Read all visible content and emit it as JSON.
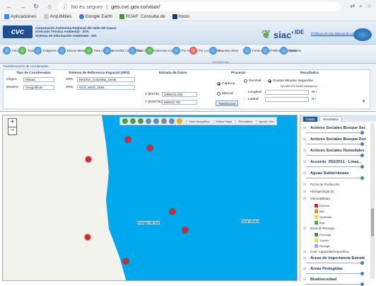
{
  "browser": {
    "security_label": "No es seguro",
    "url": "geo.cvc.gov.co/visor/",
    "bookmarks": [
      "Aplicaciones",
      "ArqUtilities",
      "Google Earth",
      "RUAF: Consulta de",
      "Inicio"
    ]
  },
  "header": {
    "logo_text": "cvc",
    "org_line1": "Corporación Autónoma Regional del Valle del Cauca",
    "org_line2": "Dirección Técnica Ambiental - DTA",
    "org_line3": "Sistema de Información Ambiental - SIA",
    "siac_label": "siac",
    "ide_label": "IDE",
    "links": "Políticas de Uso  Manual de Usuario"
  },
  "toolbar": {
    "items": [
      "Inicio",
      "Todo",
      "Imágenes raster",
      "Buscar Metadatos",
      "Para consultar",
      "Consulta Cartográfica",
      "Buscar Área",
      "Adicionar Capa",
      "Por Atributo",
      "Por Localización",
      "Exportar datos",
      "Punto / Línea",
      "Polilínea / Polígono",
      "Medición"
    ],
    "group_label": "Herramientas"
  },
  "panel": {
    "title": "Transformación de coordenadas",
    "coord_type_header": "Tipo de Coordenadas",
    "srs_header": "Sistema de Referencia Espacial (SRS)",
    "data_entry_header": "Entrada de Datos",
    "process_header": "Procesar",
    "result_header": "Resultados",
    "origin_label": "Origen:",
    "origin_value": "Planas",
    "dest_label": "Destino:",
    "dest_value": "Geográficas",
    "srs_label": "SRS:",
    "srs_origin": "MAGNA_Colombia_Oeste",
    "srs_dest": "GCS_WGS_1984",
    "x_label": "X (ESTE)",
    "x_value": "1069431.032",
    "y_label": "Y (NORTE)",
    "y_value": "869322.751",
    "capture_label": "Capturar",
    "manual_label": "Manual",
    "transform_button": "Transformar",
    "decimal_label": "Decimal",
    "gms_label": "Grados Minutos Segundos",
    "dec_grad": "DD MM SS.SSSS Hemisferio",
    "longitude_label": "Longitud:",
    "latitude_label": "Latitud:",
    "w_label": "W /",
    "n_label": "N /"
  },
  "map": {
    "zoom_in": "+",
    "zoom_out": "−",
    "points": 7,
    "label_center": "Cartago del Sur",
    "label_right": "Zona Urbana",
    "dropdowns": [
      "Vista Geográfica",
      "Estilos Mapa",
      "Resultados",
      "Ayuda / Info"
    ]
  },
  "legend": {
    "tabs": [
      "Capas",
      "Resultados"
    ],
    "items": [
      {
        "label": "Actores Sociales Bosque Sec",
        "type": "main"
      },
      {
        "label": "Actores Sociales Bosque Zon",
        "type": "main"
      },
      {
        "label": "Actores Sociales Humedales",
        "type": "main"
      },
      {
        "label": "Acuerdo_052/2011 - Linea...",
        "type": "main"
      },
      {
        "label": "Aguas Subterráneas",
        "type": "main"
      },
      {
        "label": "Pozos de Producción",
        "type": "sub"
      },
      {
        "label": "Hidrogeología (5)",
        "type": "sub"
      },
      {
        "label": "Vulnerabilidad",
        "type": "sub"
      }
    ],
    "swatches": [
      {
        "label": "Extrema",
        "color": "#e02020"
      },
      {
        "label": "Alta",
        "color": "#f08a24"
      },
      {
        "label": "Moderada",
        "color": "#f2e22a"
      },
      {
        "label": "Baja",
        "color": "#38b24b"
      }
    ],
    "recharge_label": "Zona de Recarga",
    "recharge_swatches": [
      {
        "label": "Descarga",
        "color": "#2a9a4a"
      },
      {
        "label": "Tránsito",
        "color": "#f2e22a"
      },
      {
        "label": "Recarga",
        "color": "#7fb6f0"
      }
    ],
    "tail_items": [
      "Coef. Capacidad Especifica",
      "Áreas de importancia Estraté",
      "Áreas Protegidas",
      "Biodiversidad"
    ]
  },
  "colors": {
    "sea": "#00a8ee",
    "land": "#f3f3ee",
    "brand": "#1d4f91",
    "point": "#e02323"
  }
}
